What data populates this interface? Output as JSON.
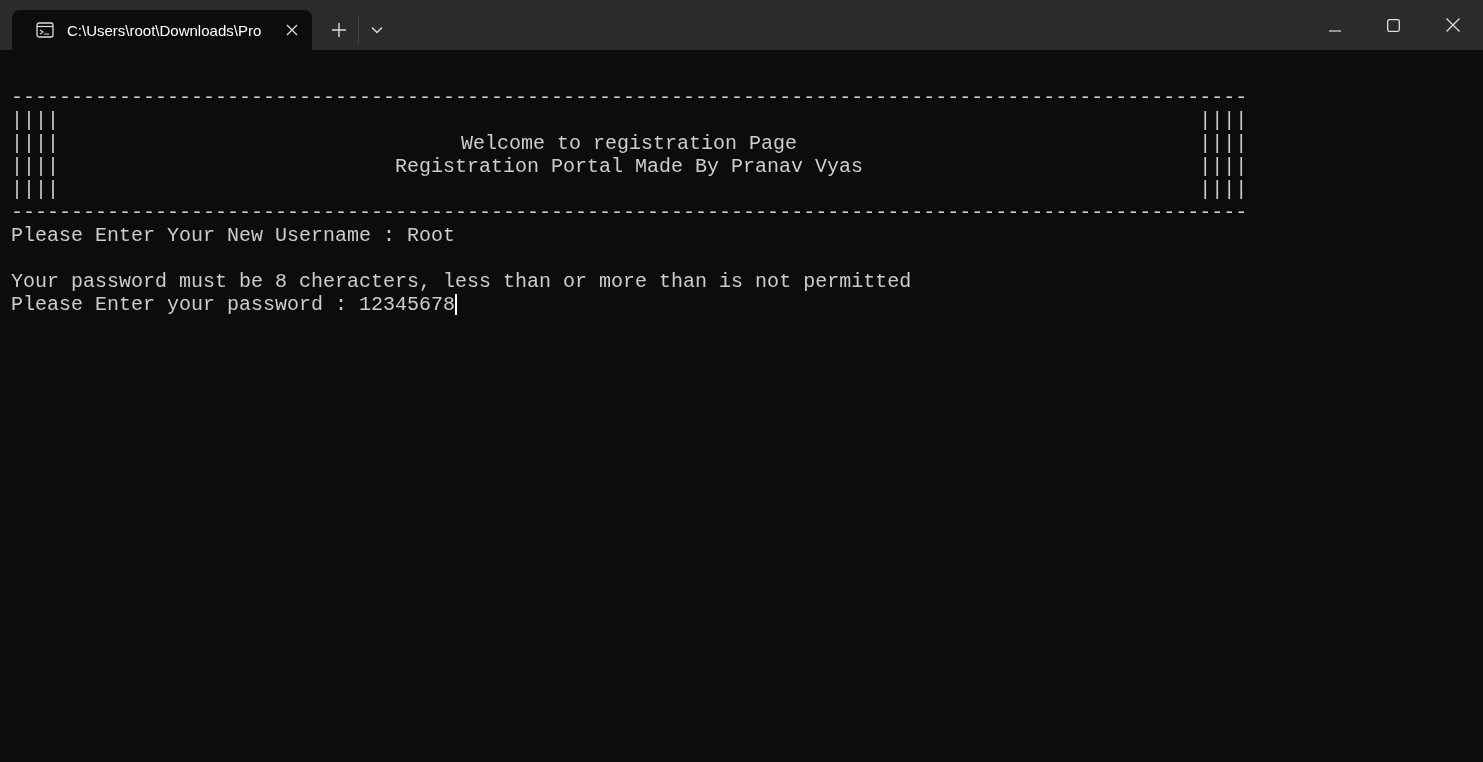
{
  "tabs": [
    {
      "title": "C:\\Users\\root\\Downloads\\Pro",
      "selected": true
    }
  ],
  "terminal": {
    "lines": [
      {
        "kind": "rule",
        "text": "-------------------------------------------------------------------------------------------------------"
      },
      {
        "kind": "banner",
        "left": "||||",
        "right": "||||"
      },
      {
        "kind": "banner",
        "left": "||||",
        "text": "Welcome to registration Page",
        "right": "||||"
      },
      {
        "kind": "banner",
        "left": "||||",
        "text": "Registration Portal Made By Pranav Vyas",
        "right": "||||"
      },
      {
        "kind": "banner",
        "left": "||||",
        "right": "||||"
      },
      {
        "kind": "rule",
        "text": "-------------------------------------------------------------------------------------------------------"
      },
      {
        "kind": "text",
        "text": "Please Enter Your New Username : Root"
      },
      {
        "kind": "blank"
      },
      {
        "kind": "text",
        "text": "Your password must be 8 cheracters, less than or more than is not permitted"
      },
      {
        "kind": "text",
        "text": "Please Enter your password : 12345678",
        "cursor": true
      }
    ]
  }
}
